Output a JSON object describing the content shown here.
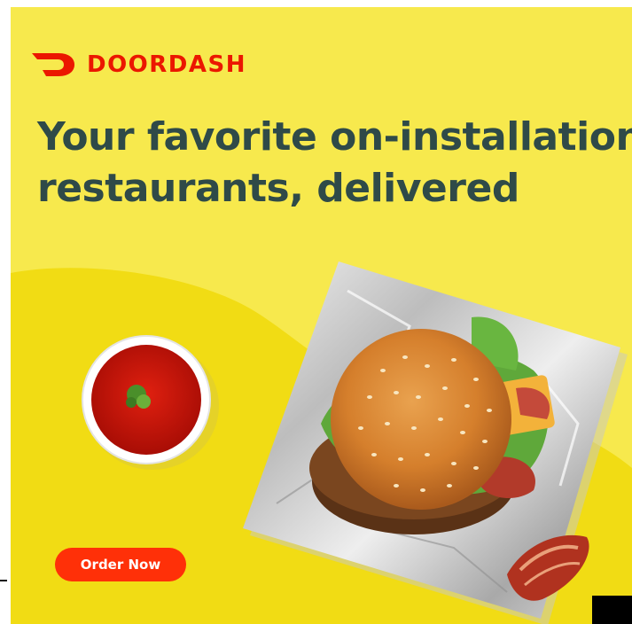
{
  "ad": {
    "brand": "DOORDASH",
    "brand_icon": "doordash-logo-icon",
    "headline_line1": "Your favorite on-installation",
    "headline_line2": "restaurants, delivered",
    "cta_label": "Order Now",
    "images": [
      "tomato-sauce-bowl",
      "burger-on-foil",
      "bacon-strip"
    ]
  },
  "colors": {
    "background": "#f7e94d",
    "wave": "#f1dc14",
    "brand_red": "#eb1700",
    "cta_red": "#ff3008",
    "headline": "#2f4a48"
  }
}
